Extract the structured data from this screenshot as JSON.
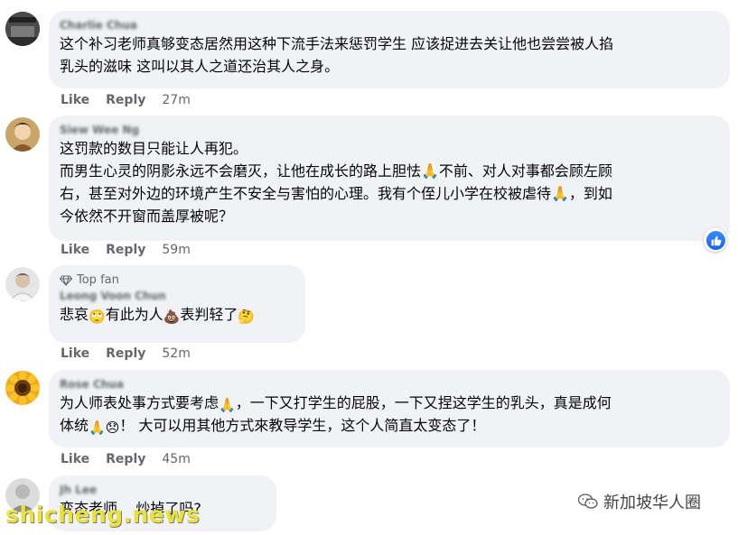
{
  "comments": [
    {
      "author": "Charlie Chua",
      "text": "这个补习老师真够变态居然用这种下流手法来惩罚学生 应该捉进去关让他也尝尝被人掐\n乳头的滋味 这叫以其人之道还治其人之身。",
      "like": "Like",
      "reply": "Reply",
      "time": "27m"
    },
    {
      "author": "Siew Wee Ng",
      "text": "这罚款的数目只能让人再犯。\n而男生心灵的阴影永远不会磨灭，让他在成长的路上胆怯🙏不前、对人对事都会顾左顾\n右，甚至对外边的环境产生不安全与害怕的心理。我有个侄儿小学在校被虐待🙏，到如\n今依然不开窗而盖厚被呢？",
      "like": "Like",
      "reply": "Reply",
      "time": "59m"
    },
    {
      "badge": "Top fan",
      "author": "Leong Voon Chun",
      "text_a": "悲哀",
      "text_b": "有此为人",
      "text_c": "表判轻了",
      "like": "Like",
      "reply": "Reply",
      "time": "52m"
    },
    {
      "author": "Rose Chua",
      "text_a": "为人师表处事方式要考虑",
      "text_b": "，一下又打学生的屁股，一下又捏这学生的乳头，真是成何",
      "text_c": "体统",
      "text_d": "！ 大可以用其他方式來教导学生，这个人简直太变态了！",
      "like": "Like",
      "reply": "Reply",
      "time": "45m"
    },
    {
      "author": "Jh Lee",
      "text_a": "变态老师",
      "text_b": "炒掉了吗?"
    }
  ],
  "icons": {
    "like_badge": "thumbs-up-icon",
    "top_fan": "diamond-icon",
    "emoji_1": "rolling-eyes-emoji",
    "emoji_2": "poop-emoji",
    "emoji_3": "thinking-emoji",
    "emoji_4": "sad-emoji",
    "placeholder": "missing-glyph-icon"
  },
  "watermark": {
    "left": "shicheng.news",
    "right": "新加坡华人圈"
  },
  "colors": {
    "bubble": "#f0f2f5",
    "action_text": "#65676b",
    "like_blue": "#1877f2"
  }
}
